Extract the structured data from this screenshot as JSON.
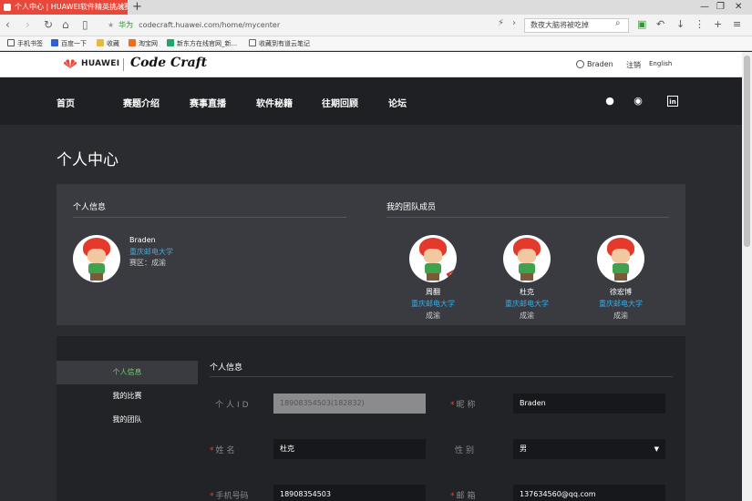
{
  "browser": {
    "tab_title": "个人中心 | HUAWEI软件精英挑战赛",
    "url_secure": "华为",
    "url": "codecraft.huawei.com/home/mycenter",
    "search_text": "数夜大脑将被吃掉",
    "bookmarks": [
      "手机书签",
      "百度一下",
      "收藏",
      "淘宝网",
      "新东方在线官网_新...",
      "收藏到有道云笔记"
    ]
  },
  "site": {
    "brand": "HUAWEI",
    "product": "Code Craft",
    "user": "Braden",
    "logout": "注销",
    "lang": "English",
    "nav": [
      "首页",
      "赛题介绍",
      "赛事直播",
      "软件秘籍",
      "往期回顾",
      "论坛"
    ]
  },
  "page": {
    "title": "个人中心",
    "info_heading": "个人信息",
    "team_heading": "我的团队成员",
    "me": {
      "name": "Braden",
      "school": "重庆邮电大学",
      "region": "赛区：成渝"
    },
    "members": [
      {
        "name": "周翻",
        "school": "重庆邮电大学",
        "region": "成渝",
        "leader_tag": "队长"
      },
      {
        "name": "杜克",
        "school": "重庆邮电大学",
        "region": "成渝"
      },
      {
        "name": "徐宏博",
        "school": "重庆邮电大学",
        "region": "成渝"
      }
    ]
  },
  "sidebar": {
    "items": [
      {
        "label": "个人信息",
        "active": true
      },
      {
        "label": "我的比赛",
        "active": false
      },
      {
        "label": "我的团队",
        "active": false
      }
    ]
  },
  "form": {
    "title": "个人信息",
    "id_label": "个人ID",
    "id_value": "18908354503(182832)",
    "nick_label": "昵称",
    "nick_value": "Braden",
    "name_label": "姓名",
    "name_value": "杜克",
    "gender_label": "性别",
    "gender_value": "男",
    "phone_label": "手机号码",
    "phone_value": "18908354503",
    "email_label": "邮箱",
    "email_value": "137634560@qq.com"
  },
  "colors": {
    "accent_green": "#6bd16b",
    "link_blue": "#3fa9e0",
    "brand_red": "#e8483a"
  }
}
